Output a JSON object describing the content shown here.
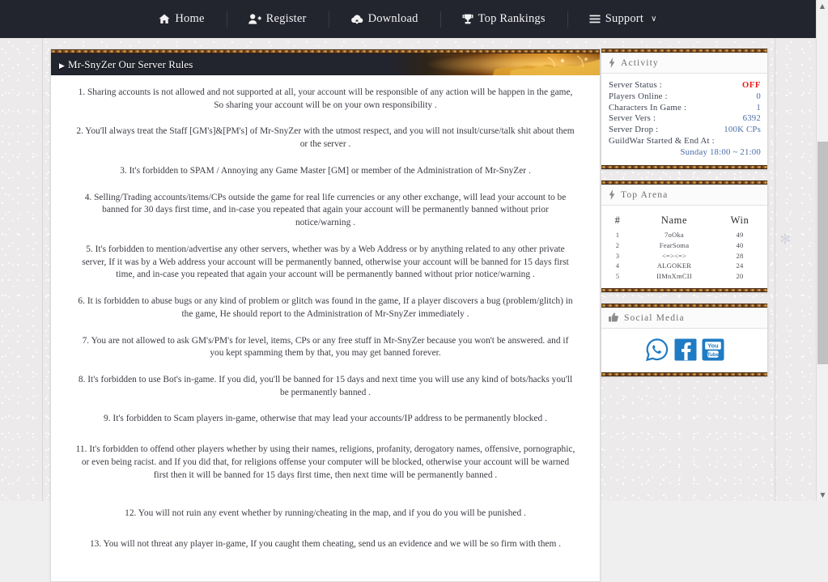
{
  "nav": {
    "items": [
      {
        "label": "Home",
        "icon": "home-icon"
      },
      {
        "label": "Register",
        "icon": "user-plus-icon"
      },
      {
        "label": "Download",
        "icon": "cloud-download-icon"
      },
      {
        "label": "Top Rankings",
        "icon": "trophy-icon"
      },
      {
        "label": "Support",
        "icon": "bars-icon",
        "caret": "∨"
      }
    ]
  },
  "main": {
    "header": {
      "arrow": "▶",
      "title": "Mr-SnyZer Our Server Rules"
    },
    "rules": [
      "1. Sharing accounts is not allowed and not supported at all, your account will be responsible of any action will be happen in the game, So sharing your account will be on your own responsibility .",
      "2. You'll always treat the Staff [GM's]&[PM's] of Mr-SnyZer with the utmost respect, and you will not insult/curse/talk shit about them or the server .",
      "3. It's forbidden to SPAM / Annoying any Game Master [GM] or member of the Administration of Mr-SnyZer .",
      "4. Selling/Trading accounts/items/CPs outside the game for real life currencies or any other exchange, will lead your account to be banned for 30 days first time, and in-case you repeated that again your account will be permanently banned without prior notice/warning .",
      "5. It's forbidden to mention/advertise any other servers, whether was by a Web Address or by anything related to any other private server, If it was by a Web address your account will be permanently banned, otherwise your account will be banned for 15 days first time, and in-case you repeated that again your account will be permanently banned without prior notice/warning .",
      "6. It is forbidden to abuse bugs or any kind of problem or glitch was found in the game, If a player discovers a bug (problem/glitch) in the game, He should report to the Administration of Mr-SnyZer immediately .",
      "7. You are not allowed to ask GM's/PM's for level, items, CPs or any free stuff in Mr-SnyZer because you won't be answered. and if you kept spamming them by that, you may get banned forever.",
      "8. It's forbidden to use Bot's in-game. If you did, you'll be banned for 15 days and next time you will use any kind of bots/hacks you'll be permanently banned .",
      "9. It's forbidden to Scam players in-game, otherwise that may lead your accounts/IP address to be permanently blocked .",
      "11. It's forbidden to offend other players whether by using their names, religions, profanity, derogatory names, offensive, pornographic, or even being racist. and If you did that, for religions offense your computer will be blocked, otherwise your account will be warned first then it will be banned for 15 days first time, then next time will be permanently banned .",
      "12. You will not ruin any event whether by running/cheating in the map, and if you do you will be punished .",
      "13. You will not threat any player in-game, If you caught them cheating, send us an evidence and we will be so firm with them ."
    ]
  },
  "sidebar": {
    "activity": {
      "icon": "bolt-icon",
      "title": "Activity",
      "rows": [
        {
          "label": "Server Status :",
          "value": "OFF",
          "status": "off"
        },
        {
          "label": "Players Online :",
          "value": "0"
        },
        {
          "label": "Characters In Game :",
          "value": "1"
        },
        {
          "label": "Server Vers :",
          "value": "6392"
        },
        {
          "label": "Server Drop :",
          "value": "100K CPs"
        }
      ],
      "guildwar_label": "GuildWar Started & End At :",
      "guildwar_value": "Sunday 18:00 ~ 21:00"
    },
    "arena": {
      "icon": "bolt-icon",
      "title": "Top Arena",
      "columns": {
        "rank": "#",
        "name": "Name",
        "win": "Win"
      },
      "rows": [
        {
          "rank": "1",
          "name": "7oOka",
          "win": "49"
        },
        {
          "rank": "2",
          "name": "FearSoma",
          "win": "40"
        },
        {
          "rank": "3",
          "name": "<=><=>",
          "win": "28"
        },
        {
          "rank": "4",
          "name": "ALGOKER",
          "win": "24"
        },
        {
          "rank": "5",
          "name": "IIMnXmCII",
          "win": "20"
        }
      ]
    },
    "social": {
      "icon": "thumbs-up-icon",
      "title": "Social Media",
      "links": [
        {
          "name": "whatsapp-icon",
          "color": "#1f7bc4"
        },
        {
          "name": "facebook-icon",
          "color": "#1f7bc4"
        },
        {
          "name": "youtube-icon",
          "color": "#1f7bc4"
        }
      ]
    }
  },
  "decor": {
    "snowflake": "✻"
  },
  "scrollbar": {
    "up": "▲",
    "down": "▼"
  }
}
